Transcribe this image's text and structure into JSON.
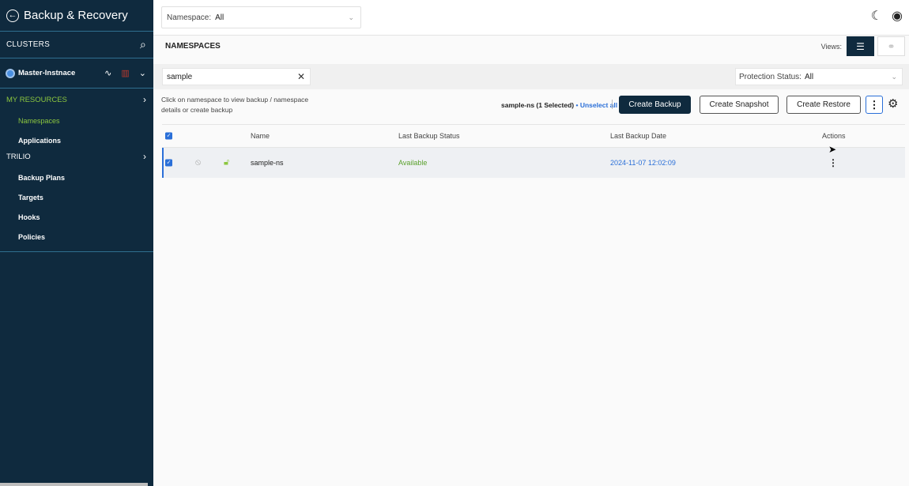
{
  "sidebar": {
    "title": "Backup & Recovery",
    "clusters_label": "CLUSTERS",
    "cluster_name": "Master-Instnace",
    "my_resources_label": "MY RESOURCES",
    "my_resources_items": [
      "Namespaces",
      "Applications"
    ],
    "trilio_label": "TRILIO",
    "trilio_items": [
      "Backup Plans",
      "Targets",
      "Hooks",
      "Policies"
    ]
  },
  "topbar": {
    "namespace_label": "Namespace:",
    "namespace_value": "All"
  },
  "page": {
    "title": "NAMESPACES",
    "views_label": "Views:"
  },
  "filters": {
    "search_value": "sample",
    "protection_label": "Protection Status:",
    "protection_value": "All"
  },
  "actions": {
    "hint": "Click on namespace to view backup / namespace details or create backup",
    "selected_text": "sample-ns (1 Selected)",
    "unselect_label": "• Unselect all",
    "create_backup": "Create Backup",
    "create_snapshot": "Create Snapshot",
    "create_restore": "Create Restore"
  },
  "table": {
    "headers": {
      "name": "Name",
      "status": "Last Backup Status",
      "date": "Last Backup Date",
      "actions": "Actions"
    },
    "rows": [
      {
        "name": "sample-ns",
        "status": "Available",
        "date": "2024-11-07 12:02:09"
      }
    ]
  },
  "colors": {
    "sidebar_bg": "#0f2a3e",
    "accent_green": "#8cc63f",
    "accent_blue": "#2a6fd8",
    "primary_button": "#0f2a3e"
  }
}
